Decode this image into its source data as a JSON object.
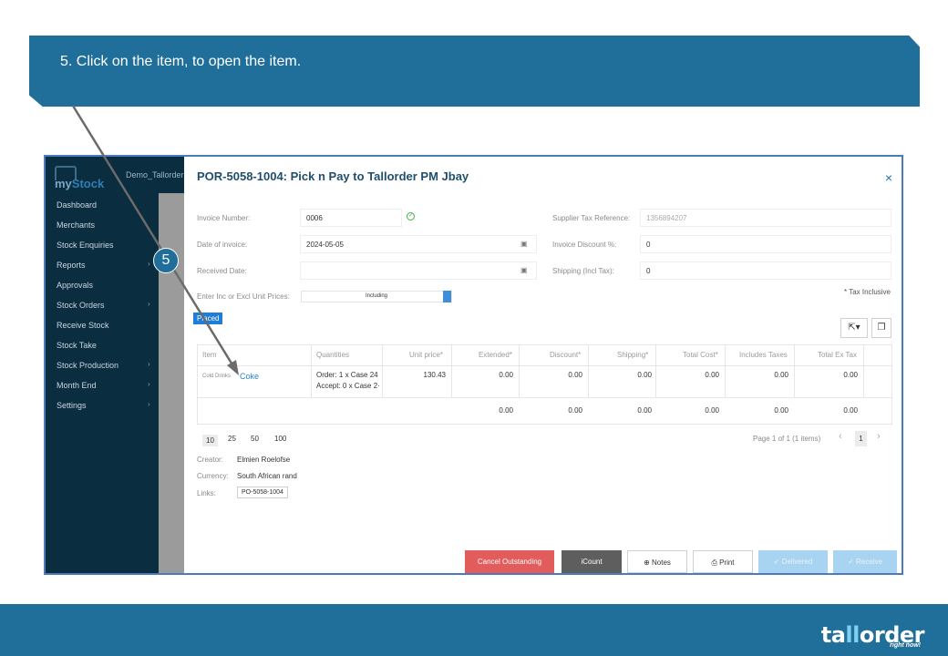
{
  "banner": {
    "text": "5. Click on the item, to open the item."
  },
  "footer": {
    "logo_part1": "ta",
    "logo_part2": "ll",
    "logo_part3": "order",
    "logo_tagline": "right now!"
  },
  "step": {
    "number": "5"
  },
  "app": {
    "brand_name_a": "my",
    "brand_name_b": "Stock",
    "user": "Demo_Tallorder",
    "sidebar": [
      {
        "label": "Dashboard",
        "arrow": ""
      },
      {
        "label": "Merchants",
        "arrow": ""
      },
      {
        "label": "Stock Enquiries",
        "arrow": ""
      },
      {
        "label": "Reports",
        "arrow": "›"
      },
      {
        "label": "Approvals",
        "arrow": ""
      },
      {
        "label": "Stock Orders",
        "arrow": "›"
      },
      {
        "label": "Receive Stock",
        "arrow": ""
      },
      {
        "label": "Stock Take",
        "arrow": ""
      },
      {
        "label": "Stock Production",
        "arrow": "›"
      },
      {
        "label": "Month End",
        "arrow": "›"
      },
      {
        "label": "Settings",
        "arrow": "›"
      }
    ]
  },
  "modal": {
    "title": "POR-5058-1004: Pick n Pay to Tallorder PM Jbay",
    "close": "×",
    "invoice_number_label": "Invoice Number:",
    "invoice_number": "0006",
    "date_label": "Date of invoice:",
    "date_value": "2024-05-05",
    "received_label": "Received Date:",
    "received_value": "",
    "unit_prices_label": "Enter Inc or Excl Unit Prices:",
    "unit_prices_value": "Including",
    "supplier_tax_label": "Supplier Tax Reference:",
    "supplier_tax_value": "1356894207",
    "invoice_discount_label": "Invoice Discount %:",
    "invoice_discount_value": "0",
    "shipping_label": "Shipping (Incl Tax):",
    "shipping_value": "0",
    "tax_inclusive": "* Tax Inclusive",
    "status": "Placed",
    "table": {
      "headers": [
        "Item",
        "Quantities",
        "Unit price*",
        "Extended*",
        "Discount*",
        "Shipping*",
        "Total Cost*",
        "Includes Taxes",
        "Total Ex Tax"
      ],
      "row": {
        "category": "Cold Drinks",
        "item": "Coke",
        "qty_order": "Order: 1 x Case 24",
        "qty_accept": "Accept: 0 x Case 2·",
        "unit_price": "130.43",
        "extended": "0.00",
        "discount": "0.00",
        "shipping": "0.00",
        "total_cost": "0.00",
        "includes_taxes": "0.00",
        "total_ex_tax": "0.00"
      },
      "totals": {
        "extended": "0.00",
        "discount": "0.00",
        "shipping": "0.00",
        "total_cost": "0.00",
        "includes_taxes": "0.00",
        "total_ex_tax": "0.00"
      }
    },
    "pager": {
      "sizes": [
        "10",
        "25",
        "50",
        "100"
      ],
      "info": "Page 1 of 1 (1 items)",
      "prev": "‹",
      "current": "1",
      "next": "›"
    },
    "creator_label": "Creator:",
    "creator": "Elmien Roelofse",
    "currency_label": "Currency:",
    "currency": "South African rand",
    "links_label": "Links:",
    "link": "PO-5058-1004",
    "buttons": {
      "cancel": "Cancel Outstanding",
      "icount": "iCount",
      "notes": "Notes",
      "print": "Print",
      "delivered": "✓ Delivered",
      "receive": "✓ Receive"
    }
  }
}
